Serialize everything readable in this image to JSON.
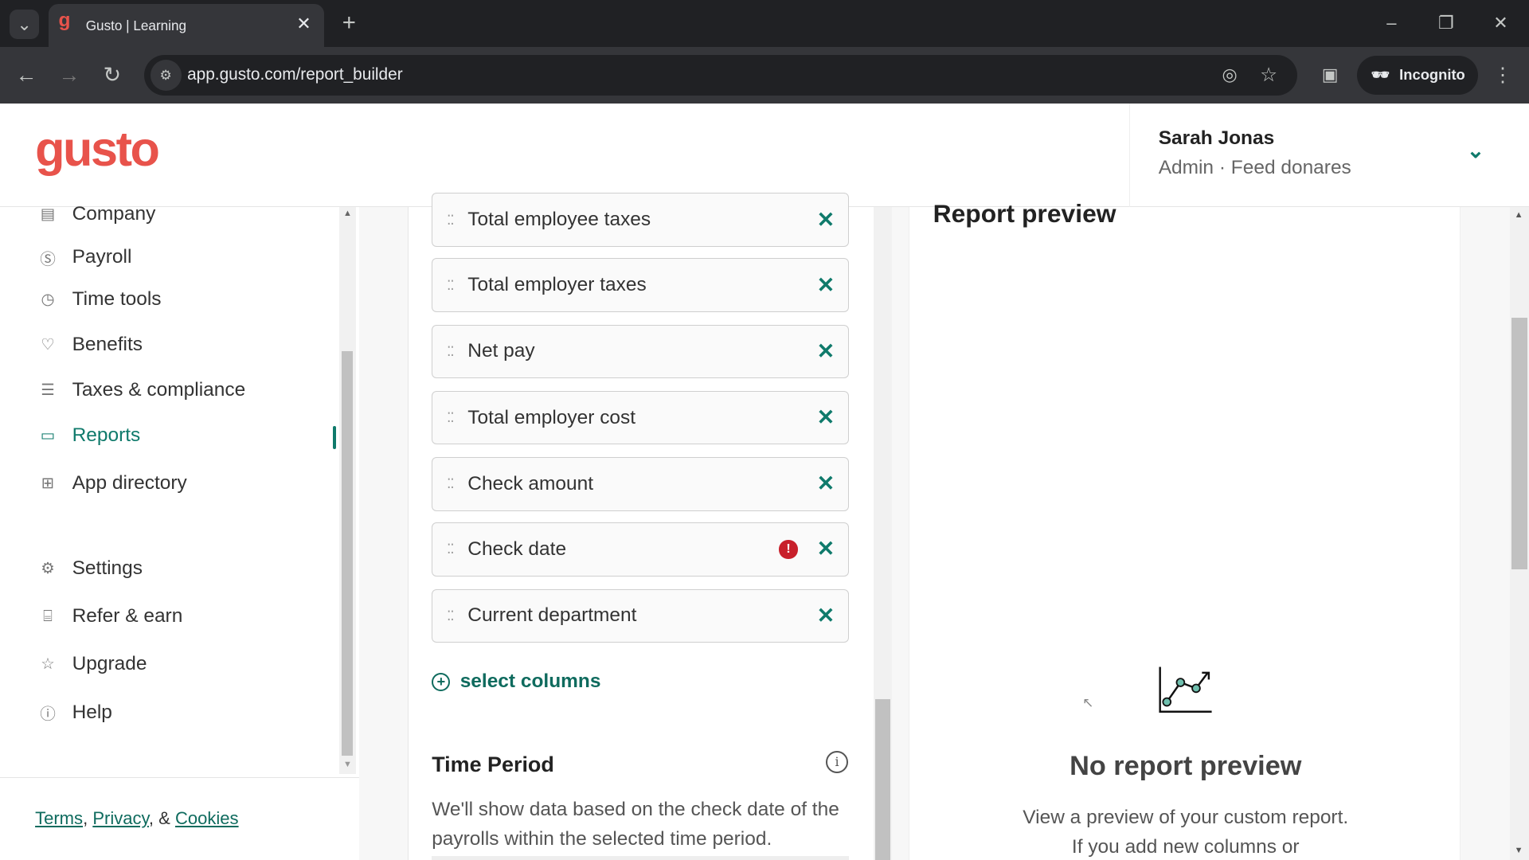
{
  "browser": {
    "tab_title": "Gusto | Learning",
    "url": "app.gusto.com/report_builder",
    "incognito_label": "Incognito"
  },
  "header": {
    "logo": "gusto",
    "user_name": "Sarah Jonas",
    "user_role": "Admin · Feed donares"
  },
  "sidebar": {
    "items": [
      {
        "label": "Company",
        "icon": "building-icon"
      },
      {
        "label": "Payroll",
        "icon": "dollar-icon"
      },
      {
        "label": "Time tools",
        "icon": "clock-icon"
      },
      {
        "label": "Benefits",
        "icon": "heart-icon"
      },
      {
        "label": "Taxes & compliance",
        "icon": "list-icon"
      },
      {
        "label": "Reports",
        "icon": "folder-icon",
        "active": true
      },
      {
        "label": "App directory",
        "icon": "grid-icon"
      },
      {
        "label": "Settings",
        "icon": "gear-icon"
      },
      {
        "label": "Refer & earn",
        "icon": "gift-icon"
      },
      {
        "label": "Upgrade",
        "icon": "star-icon"
      },
      {
        "label": "Help",
        "icon": "help-icon"
      }
    ],
    "footer": {
      "terms": "Terms",
      "sep1": ",",
      "privacy": "Privacy",
      "sep2": ", &",
      "cookies": "Cookies"
    }
  },
  "columns": [
    {
      "label": "Total employee taxes"
    },
    {
      "label": "Total employer taxes"
    },
    {
      "label": "Net pay"
    },
    {
      "label": "Total employer cost"
    },
    {
      "label": "Check amount"
    },
    {
      "label": "Check date",
      "warning": true
    },
    {
      "label": "Current department"
    }
  ],
  "select_columns": "select columns",
  "time_period": {
    "title": "Time Period",
    "description": "We'll show data based on the check date of the payrolls within the selected time period."
  },
  "preview": {
    "title": "Report preview",
    "empty_title": "No report preview",
    "empty_text": "View a preview of your custom report. If you add new columns or"
  },
  "colors": {
    "brand": "#e8534b",
    "accent": "#0f7a6b",
    "warning": "#c8202b"
  }
}
